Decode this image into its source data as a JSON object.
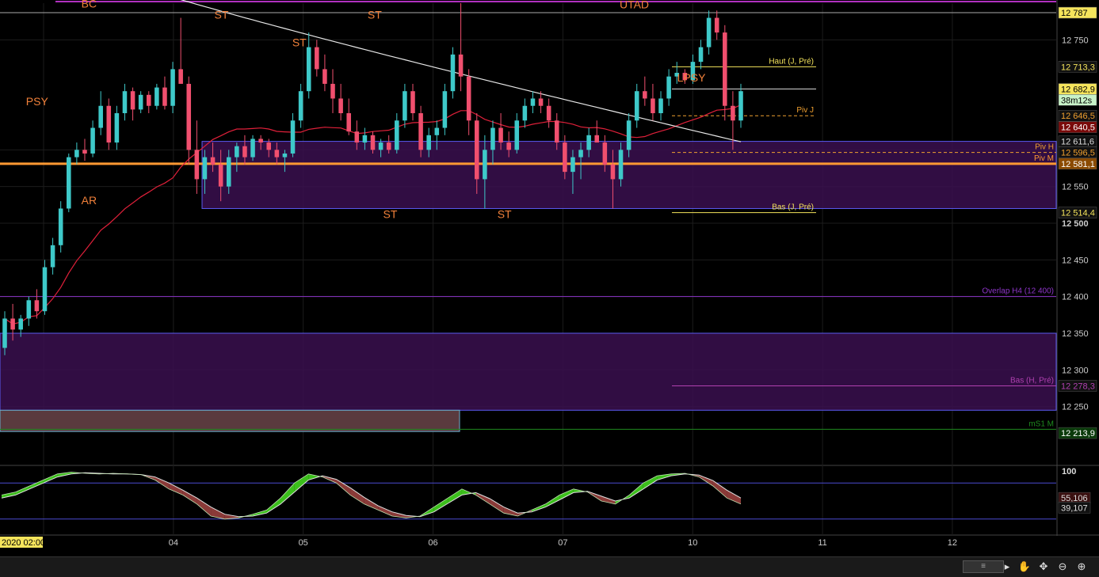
{
  "chart_data": {
    "type": "candlestick",
    "title": "",
    "price_axis": {
      "ticks": [
        {
          "value": 12750,
          "label": "12 750"
        },
        {
          "value": 12600,
          "label": "12 600"
        },
        {
          "value": 12550,
          "label": "12 550"
        },
        {
          "value": 12500,
          "label": "12 500",
          "bold": true
        },
        {
          "value": 12450,
          "label": "12 450"
        },
        {
          "value": 12400,
          "label": "12 400"
        },
        {
          "value": 12350,
          "label": "12 350"
        },
        {
          "value": 12300,
          "label": "12 300"
        },
        {
          "value": 12250,
          "label": "12 250"
        }
      ],
      "range": [
        12200,
        12800
      ]
    },
    "time_axis": {
      "labels": [
        {
          "day": 3.0,
          "label": "2020 02:00",
          "boxed": true
        },
        {
          "day": 4.0,
          "label": "04"
        },
        {
          "day": 5.0,
          "label": "05"
        },
        {
          "day": 6.0,
          "label": "06"
        },
        {
          "day": 7.0,
          "label": "07"
        },
        {
          "day": 8.0,
          "label": "10"
        },
        {
          "day": 9.0,
          "label": "11"
        },
        {
          "day": 10.0,
          "label": "12"
        }
      ],
      "range": [
        3.0,
        10.8
      ]
    },
    "candles": [
      [
        12330,
        12380,
        12320,
        12370
      ],
      [
        12370,
        12390,
        12340,
        12355
      ],
      [
        12355,
        12375,
        12345,
        12370
      ],
      [
        12370,
        12400,
        12360,
        12395
      ],
      [
        12395,
        12410,
        12370,
        12380
      ],
      [
        12380,
        12450,
        12375,
        12440
      ],
      [
        12440,
        12480,
        12430,
        12470
      ],
      [
        12470,
        12530,
        12460,
        12520
      ],
      [
        12520,
        12595,
        12515,
        12590
      ],
      [
        12590,
        12610,
        12580,
        12600
      ],
      [
        12600,
        12615,
        12585,
        12595
      ],
      [
        12595,
        12640,
        12590,
        12630
      ],
      [
        12630,
        12680,
        12620,
        12660
      ],
      [
        12660,
        12670,
        12600,
        12610
      ],
      [
        12610,
        12660,
        12600,
        12650
      ],
      [
        12650,
        12690,
        12640,
        12680
      ],
      [
        12680,
        12685,
        12640,
        12655
      ],
      [
        12655,
        12680,
        12650,
        12675
      ],
      [
        12675,
        12680,
        12650,
        12660
      ],
      [
        12660,
        12690,
        12655,
        12685
      ],
      [
        12685,
        12700,
        12655,
        12660
      ],
      [
        12660,
        12720,
        12650,
        12710
      ],
      [
        12710,
        12780,
        12700,
        12690
      ],
      [
        12690,
        12700,
        12580,
        12600
      ],
      [
        12600,
        12640,
        12540,
        12560
      ],
      [
        12560,
        12600,
        12540,
        12590
      ],
      [
        12590,
        12610,
        12570,
        12580
      ],
      [
        12580,
        12600,
        12530,
        12550
      ],
      [
        12550,
        12600,
        12540,
        12590
      ],
      [
        12590,
        12610,
        12570,
        12605
      ],
      [
        12605,
        12620,
        12580,
        12590
      ],
      [
        12590,
        12620,
        12585,
        12615
      ],
      [
        12615,
        12620,
        12600,
        12610
      ],
      [
        12610,
        12615,
        12590,
        12600
      ],
      [
        12600,
        12610,
        12580,
        12590
      ],
      [
        12590,
        12600,
        12570,
        12595
      ],
      [
        12595,
        12650,
        12590,
        12640
      ],
      [
        12640,
        12690,
        12630,
        12680
      ],
      [
        12680,
        12760,
        12670,
        12740
      ],
      [
        12740,
        12750,
        12700,
        12710
      ],
      [
        12710,
        12730,
        12680,
        12690
      ],
      [
        12690,
        12710,
        12650,
        12670
      ],
      [
        12670,
        12690,
        12640,
        12650
      ],
      [
        12650,
        12670,
        12620,
        12625
      ],
      [
        12625,
        12640,
        12600,
        12610
      ],
      [
        12610,
        12630,
        12600,
        12620
      ],
      [
        12620,
        12625,
        12595,
        12600
      ],
      [
        12600,
        12615,
        12590,
        12610
      ],
      [
        12610,
        12620,
        12595,
        12600
      ],
      [
        12600,
        12650,
        12595,
        12640
      ],
      [
        12640,
        12690,
        12630,
        12680
      ],
      [
        12680,
        12690,
        12640,
        12650
      ],
      [
        12650,
        12660,
        12590,
        12600
      ],
      [
        12600,
        12630,
        12590,
        12620
      ],
      [
        12620,
        12640,
        12600,
        12630
      ],
      [
        12630,
        12690,
        12620,
        12680
      ],
      [
        12680,
        12740,
        12670,
        12730
      ],
      [
        12730,
        12800,
        12680,
        12700
      ],
      [
        12700,
        12710,
        12620,
        12640
      ],
      [
        12640,
        12650,
        12540,
        12560
      ],
      [
        12560,
        12620,
        12520,
        12600
      ],
      [
        12600,
        12640,
        12580,
        12630
      ],
      [
        12630,
        12650,
        12600,
        12610
      ],
      [
        12610,
        12625,
        12590,
        12600
      ],
      [
        12600,
        12650,
        12595,
        12640
      ],
      [
        12640,
        12670,
        12630,
        12660
      ],
      [
        12660,
        12680,
        12650,
        12670
      ],
      [
        12670,
        12680,
        12650,
        12660
      ],
      [
        12660,
        12670,
        12630,
        12640
      ],
      [
        12640,
        12650,
        12600,
        12610
      ],
      [
        12610,
        12620,
        12560,
        12570
      ],
      [
        12570,
        12600,
        12540,
        12590
      ],
      [
        12590,
        12610,
        12560,
        12600
      ],
      [
        12600,
        12630,
        12590,
        12620
      ],
      [
        12620,
        12640,
        12610,
        12610
      ],
      [
        12610,
        12620,
        12570,
        12580
      ],
      [
        12580,
        12600,
        12520,
        12560
      ],
      [
        12560,
        12610,
        12550,
        12600
      ],
      [
        12600,
        12650,
        12590,
        12640
      ],
      [
        12640,
        12690,
        12630,
        12680
      ],
      [
        12680,
        12700,
        12660,
        12670
      ],
      [
        12670,
        12690,
        12640,
        12650
      ],
      [
        12650,
        12680,
        12640,
        12670
      ],
      [
        12670,
        12710,
        12660,
        12700
      ],
      [
        12700,
        12720,
        12690,
        12705
      ],
      [
        12705,
        12710,
        12690,
        12695
      ],
      [
        12695,
        12730,
        12690,
        12720
      ],
      [
        12720,
        12750,
        12710,
        12740
      ],
      [
        12740,
        12790,
        12730,
        12780
      ],
      [
        12780,
        12790,
        12750,
        12760
      ],
      [
        12760,
        12770,
        12640,
        12660
      ],
      [
        12660,
        12680,
        12600,
        12640
      ],
      [
        12640,
        12690,
        12630,
        12680
      ]
    ],
    "annotations": [
      {
        "text": "BC",
        "day": 3.35,
        "price": 12794
      },
      {
        "text": "PSY",
        "day": 2.95,
        "price": 12661
      },
      {
        "text": "AR",
        "day": 3.35,
        "price": 12526
      },
      {
        "text": "ST",
        "day": 4.37,
        "price": 12779
      },
      {
        "text": "ST",
        "day": 4.97,
        "price": 12741
      },
      {
        "text": "ST",
        "day": 5.55,
        "price": 12779
      },
      {
        "text": "ST",
        "day": 5.67,
        "price": 12507
      },
      {
        "text": "ST",
        "day": 6.55,
        "price": 12507
      },
      {
        "text": "UTAD",
        "day": 7.55,
        "price": 12793
      },
      {
        "text": "LPSY",
        "day": 7.99,
        "price": 12693
      }
    ],
    "levels": [
      {
        "name": "Haut (J, Pré)",
        "value": 12713.3,
        "color": "#f5e45c"
      },
      {
        "name": "Piv J",
        "value": 12646.5,
        "color": "#f0a030",
        "dashed": true
      },
      {
        "name": "Piv H",
        "value": 12596.5,
        "color": "#f0a030",
        "dashed": true
      },
      {
        "name": "Piv M",
        "value": 12581.1,
        "color": "#ff9933"
      },
      {
        "name": "Bas (J, Pré)",
        "value": 12514.4,
        "color": "#f5e45c"
      },
      {
        "name": "Overlap H4 (12 400)",
        "value": 12400,
        "color": "#8e35c9"
      },
      {
        "name": "Bas (H, Pré)",
        "value": 12278.3,
        "color": "#b040b0"
      },
      {
        "name": "mS1 M",
        "value": 12219,
        "color": "#1f8a1f"
      }
    ],
    "price_tags": [
      {
        "label": "12 787",
        "value": 12787,
        "bg": "#f5e45c",
        "fg": "#000"
      },
      {
        "label": "12 713,3",
        "value": 12713.3,
        "bg": "#111",
        "fg": "#f5e45c"
      },
      {
        "label": "12 682,9",
        "value": 12682.9,
        "bg": "#f5e45c",
        "fg": "#000"
      },
      {
        "label": "38m12s",
        "value": 12668,
        "bg": "#c8f2c8",
        "fg": "#000"
      },
      {
        "label": "12 646,5",
        "value": 12646.5,
        "bg": "#111",
        "fg": "#f0a030"
      },
      {
        "label": "12 640,5",
        "value": 12631,
        "bg": "#7a0a0a",
        "fg": "#fff"
      },
      {
        "label": "12 611,6",
        "value": 12611.6,
        "bg": "#111",
        "fg": "#ddd"
      },
      {
        "label": "12 596,5",
        "value": 12596.5,
        "bg": "#111",
        "fg": "#f0a030"
      },
      {
        "label": "12 581,1",
        "value": 12581.1,
        "bg": "#8b4a00",
        "fg": "#fff"
      },
      {
        "label": "12 514,4",
        "value": 12514.4,
        "bg": "#111",
        "fg": "#f5e45c"
      },
      {
        "label": "12 278,3",
        "value": 12278.3,
        "bg": "#111",
        "fg": "#b040b0"
      },
      {
        "label": "12 213,9",
        "value": 12213.9,
        "bg": "#0a3a0a",
        "fg": "#fff"
      }
    ],
    "oscillator": {
      "ticks": [
        {
          "value": 100,
          "label": "100"
        }
      ],
      "tags": [
        {
          "label": "55,106",
          "value": 55.1,
          "bg": "#3a1010",
          "fg": "#ddd"
        },
        {
          "label": "39,107",
          "value": 39.1,
          "bg": "#111",
          "fg": "#ddd"
        }
      ],
      "upper": 80,
      "lower": 20,
      "fast": [
        60,
        65,
        75,
        85,
        95,
        98,
        96,
        95,
        96,
        95,
        94,
        85,
        70,
        60,
        45,
        25,
        20,
        22,
        28,
        35,
        55,
        80,
        95,
        90,
        80,
        60,
        45,
        35,
        25,
        22,
        25,
        40,
        55,
        70,
        60,
        45,
        30,
        25,
        35,
        45,
        60,
        70,
        65,
        50,
        45,
        60,
        80,
        92,
        95,
        96,
        90,
        75,
        55,
        45
      ],
      "slow": [
        55,
        60,
        70,
        80,
        90,
        95,
        97,
        96,
        95,
        95,
        94,
        90,
        80,
        68,
        55,
        40,
        28,
        24,
        25,
        30,
        45,
        65,
        85,
        92,
        86,
        72,
        56,
        42,
        32,
        26,
        24,
        32,
        46,
        60,
        64,
        54,
        40,
        30,
        32,
        40,
        52,
        64,
        66,
        58,
        50,
        55,
        70,
        85,
        92,
        95,
        93,
        84,
        68,
        55
      ]
    },
    "colors": {
      "bull": "#3ec9c9",
      "bear": "#f04f6e",
      "ma_red": "#e0203a",
      "ma_white": "#e8e8e8",
      "range_fill": "#3a0f4f"
    }
  },
  "ui": {
    "toolbar_icons": [
      "scroll-bar",
      "play-icon",
      "hand-icon",
      "crosshair-icon",
      "zoom-out-icon",
      "zoom-in-icon"
    ]
  }
}
